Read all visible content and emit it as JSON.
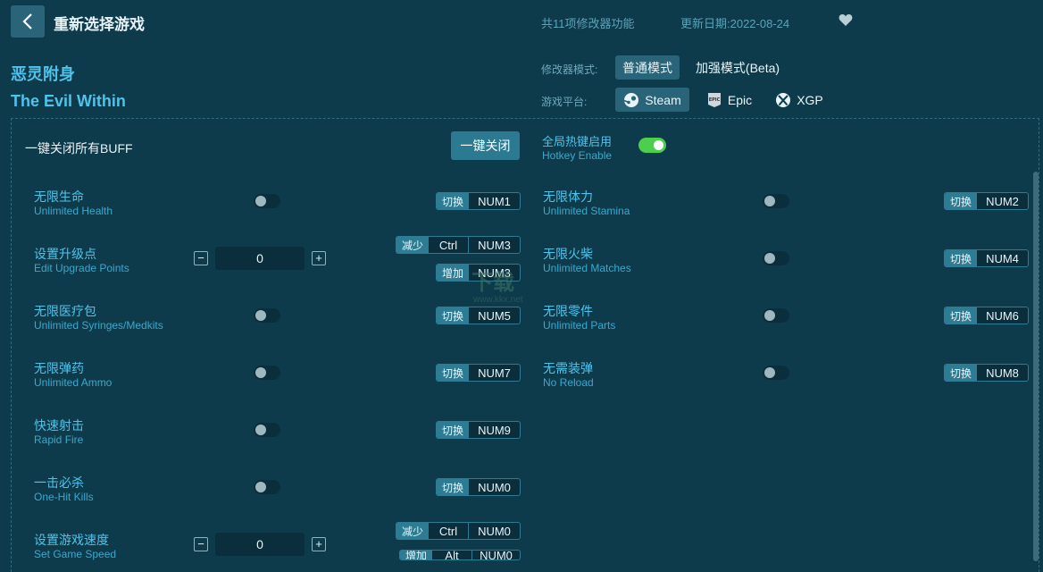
{
  "header": {
    "title": "重新选择游戏",
    "features_count": "共11项修改器功能",
    "update_date": "更新日期:2022-08-24"
  },
  "game": {
    "name_cn": "恶灵附身",
    "name_en": "The Evil Within"
  },
  "mode": {
    "label": "修改器模式:",
    "options": [
      "普通模式",
      "加强模式(Beta)"
    ]
  },
  "platform": {
    "label": "游戏平台:",
    "options": [
      "Steam",
      "Epic",
      "XGP"
    ]
  },
  "global": {
    "close_all_label": "一键关闭所有BUFF",
    "close_all_button": "一键关闭",
    "hotkey_cn": "全局热键启用",
    "hotkey_en": "Hotkey Enable"
  },
  "keys": {
    "toggle": "切换",
    "decrease": "减少",
    "increase": "增加"
  },
  "cheats": [
    {
      "cn": "无限生命",
      "en": "Unlimited Health",
      "key": "NUM1"
    },
    {
      "cn": "设置升级点",
      "en": "Edit Upgrade Points",
      "value": "0",
      "dec_mod": "Ctrl",
      "dec_key": "NUM3",
      "inc_key": "NUM3"
    },
    {
      "cn": "无限医疗包",
      "en": "Unlimited Syringes/Medkits",
      "key": "NUM5"
    },
    {
      "cn": "无限弹药",
      "en": "Unlimited Ammo",
      "key": "NUM7"
    },
    {
      "cn": "快速射击",
      "en": "Rapid Fire",
      "key": "NUM9"
    },
    {
      "cn": "一击必杀",
      "en": "One-Hit Kills",
      "key": "NUM0"
    },
    {
      "cn": "设置游戏速度",
      "en": "Set Game Speed",
      "value": "0",
      "dec_mod": "Ctrl",
      "dec_key": "NUM0",
      "inc_mod": "Alt",
      "inc_key": "NUM0"
    },
    {
      "cn": "无限体力",
      "en": "Unlimited Stamina",
      "key": "NUM2"
    },
    {
      "cn": "无限火柴",
      "en": "Unlimited Matches",
      "key": "NUM4"
    },
    {
      "cn": "无限零件",
      "en": "Unlimited Parts",
      "key": "NUM6"
    },
    {
      "cn": "无需装弹",
      "en": "No Reload",
      "key": "NUM8"
    }
  ],
  "watermark": {
    "text": "下载",
    "url": "www.kkx.net"
  },
  "colors": {
    "bg": "#0e3b4c",
    "accent": "#4fc3ea",
    "toggle_on": "#4ccf4c"
  }
}
